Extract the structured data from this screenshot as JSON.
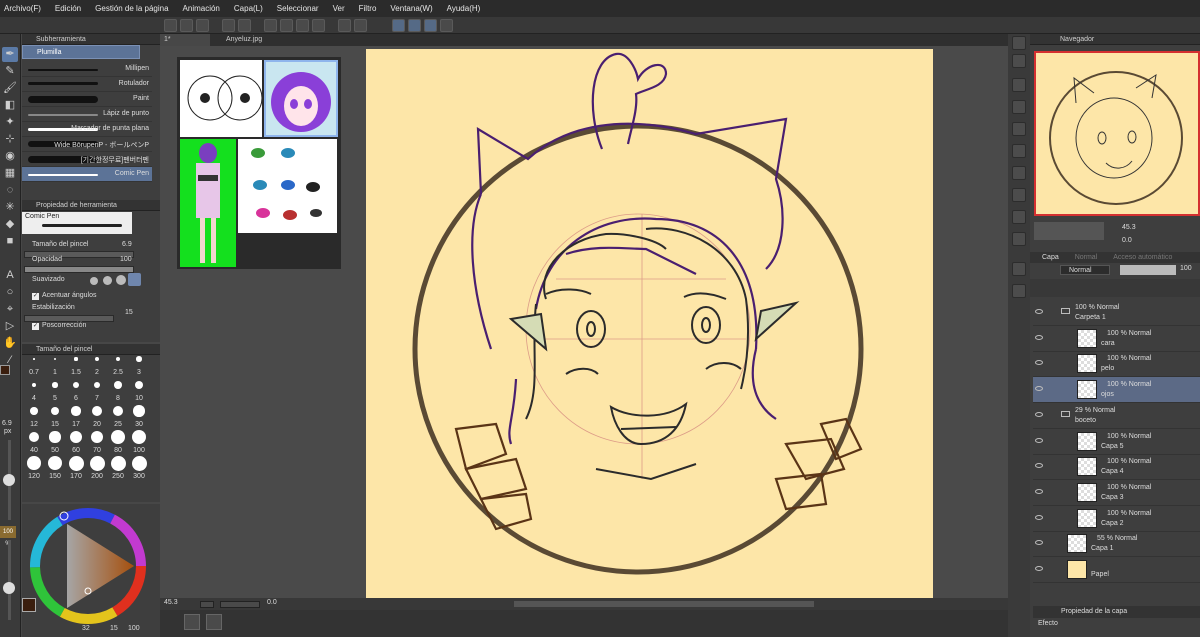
{
  "menu": [
    "Archivo(F)",
    "Edición",
    "Gestión de la página",
    "Animación",
    "Capa(L)",
    "Seleccionar",
    "Ver",
    "Filtro",
    "Ventana(W)",
    "Ayuda(H)"
  ],
  "subtool": {
    "header": "Subherramienta",
    "group": "Plumilla",
    "brushes": [
      "Millipen",
      "Rotulador",
      "Paint",
      "Lápiz de punto",
      "Marcador de punta plana",
      "Wide BōrupenP - ボールペンP",
      "[기간한정무료]펜버터펜",
      "Comic Pen"
    ]
  },
  "toolprop": {
    "header": "Propiedad de herramienta",
    "name": "Comic Pen",
    "size_label": "Tamaño del pincel",
    "size_value": "6.9",
    "opacity_label": "Opacidad",
    "opacity_value": "100",
    "smoothing_label": "Suavizado",
    "angles_label": "Acentuar ángulos",
    "stab_label": "Estabilización",
    "stab_value": "15",
    "poscor_label": "Poscorrección"
  },
  "brushsize": {
    "header": "Tamaño del pincel",
    "sizes": [
      "0.7",
      "1",
      "1.5",
      "2",
      "2.5",
      "3",
      "4",
      "5",
      "6",
      "7",
      "8",
      "10",
      "12",
      "15",
      "17",
      "20",
      "25",
      "30",
      "40",
      "50",
      "60",
      "70",
      "80",
      "100",
      "120",
      "150",
      "170",
      "200",
      "250",
      "300"
    ]
  },
  "leftstrip": {
    "size_value": "6.9",
    "size_unit": "px",
    "opacity": "100 %"
  },
  "colorbar": {
    "a": "32",
    "b": "15",
    "c": "100"
  },
  "tabs": [
    "1*",
    "Anyeluz.jpg"
  ],
  "status": {
    "zoom": "45.3",
    "rotation": "0.0"
  },
  "navigator": {
    "header": "Navegador",
    "zoom": "45.3",
    "angle": "0.0"
  },
  "layerpanel": {
    "tab1": "Capa",
    "tab2": "Normal",
    "tab3": "Acceso automático",
    "blend": "Normal",
    "opacity": "100",
    "layers": [
      {
        "t1": "100 % Normal",
        "t2": "Carpeta 1",
        "kind": "folder",
        "indent": 0
      },
      {
        "t1": "100 % Normal",
        "t2": "cara",
        "kind": "layer",
        "indent": 1
      },
      {
        "t1": "100 % Normal",
        "t2": "pelo",
        "kind": "layer",
        "indent": 1
      },
      {
        "t1": "100 % Normal",
        "t2": "ojos",
        "kind": "layer",
        "indent": 1,
        "selected": true
      },
      {
        "t1": "29 % Normal",
        "t2": "boceto",
        "kind": "folder",
        "indent": 0
      },
      {
        "t1": "100 % Normal",
        "t2": "Capa 5",
        "kind": "layer",
        "indent": 1
      },
      {
        "t1": "100 % Normal",
        "t2": "Capa 4",
        "kind": "layer",
        "indent": 1
      },
      {
        "t1": "100 % Normal",
        "t2": "Capa 3",
        "kind": "layer",
        "indent": 1
      },
      {
        "t1": "100 % Normal",
        "t2": "Capa 2",
        "kind": "layer",
        "indent": 1
      },
      {
        "t1": "55 % Normal",
        "t2": "Capa 1",
        "kind": "layer",
        "indent": 0
      },
      {
        "t1": "",
        "t2": "Papel",
        "kind": "paper",
        "indent": 0
      }
    ],
    "footer1": "Propiedad de la capa",
    "footer2": "Efecto"
  },
  "colors": {
    "main": "#3a1e0e",
    "sub": "#ffffff",
    "paper": "#fde6a8",
    "accent": "#5b7aa6"
  }
}
